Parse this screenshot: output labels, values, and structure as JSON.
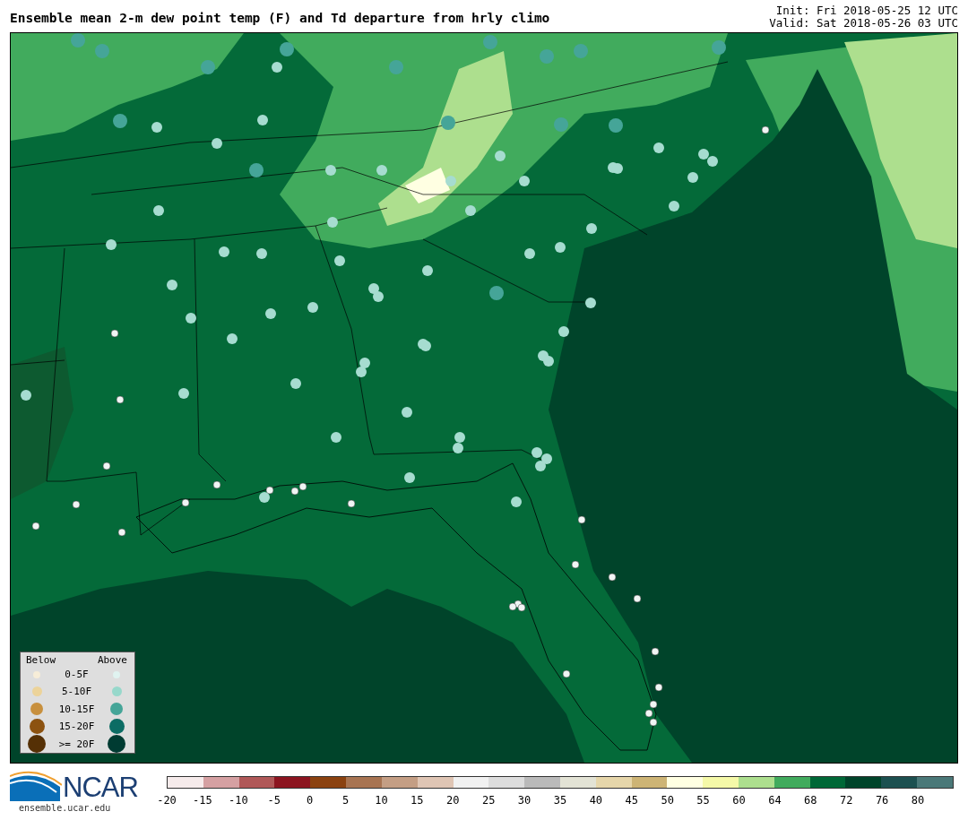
{
  "header": {
    "title": "Ensemble mean 2-m dew point temp (F) and Td departure from hrly climo",
    "init": "Init: Fri 2018-05-25 12 UTC",
    "valid": "Valid: Sat 2018-05-26 03 UTC"
  },
  "legend": {
    "below_heading": "Below",
    "above_heading": "Above",
    "rows": [
      {
        "label": "0-5F",
        "below": {
          "color": "#f7edd8"
        },
        "above": {
          "color": "#e0f3f0"
        }
      },
      {
        "label": "5-10F",
        "below": {
          "color": "#ecd39a"
        },
        "above": {
          "color": "#97d8cb"
        }
      },
      {
        "label": "10-15F",
        "below": {
          "color": "#c8903e"
        },
        "above": {
          "color": "#45a598"
        }
      },
      {
        "label": "15-20F",
        "below": {
          "color": "#8c5210"
        },
        "above": {
          "color": "#0c6c64"
        }
      },
      {
        "label": ">= 20F",
        "below": {
          "color": "#553005"
        },
        "above": {
          "color": "#003b32"
        }
      }
    ]
  },
  "logo": {
    "name": "NCAR",
    "url": "ensemble.ucar.edu"
  },
  "colorbar": {
    "segments": [
      {
        "color": "#f6ebeb"
      },
      {
        "color": "#d5a0a2"
      },
      {
        "color": "#b05858"
      },
      {
        "color": "#8c1520"
      },
      {
        "color": "#8b4210"
      },
      {
        "color": "#a87452"
      },
      {
        "color": "#c49e84"
      },
      {
        "color": "#dfc5b4"
      },
      {
        "color": "#f1f1f1"
      },
      {
        "color": "#dddddd"
      },
      {
        "color": "#bababa"
      },
      {
        "color": "#e3e3d5"
      },
      {
        "color": "#e6d6aa"
      },
      {
        "color": "#cdb475"
      },
      {
        "color": "#ffffe2"
      },
      {
        "color": "#f5f9a8"
      },
      {
        "color": "#addf8e"
      },
      {
        "color": "#41ab5d"
      },
      {
        "color": "#006837"
      },
      {
        "color": "#00442a"
      },
      {
        "color": "#1c5050"
      },
      {
        "color": "#4a7878"
      }
    ],
    "ticks": [
      "-20",
      "-15",
      "-10",
      "-5",
      "0",
      "5",
      "10",
      "15",
      "20",
      "25",
      "30",
      "35",
      "40",
      "45",
      "50",
      "55",
      "60",
      "64",
      "68",
      "72",
      "76",
      "80"
    ]
  }
}
